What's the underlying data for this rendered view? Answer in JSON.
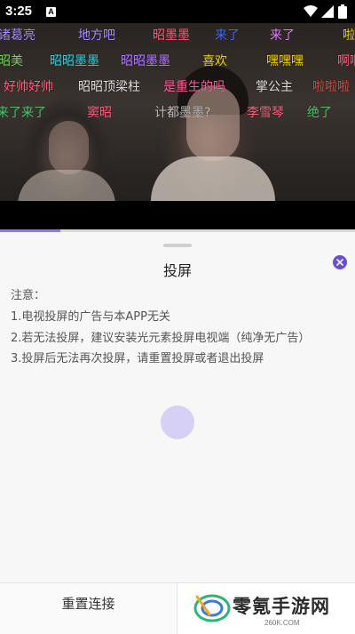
{
  "status": {
    "time": "3:25",
    "notification_glyph": "A"
  },
  "danmaku": [
    {
      "text": "诸葛亮",
      "color": "#a78bfa"
    },
    {
      "text": "地方吧",
      "color": "#a78bfa"
    },
    {
      "text": "昭墨墨",
      "color": "#ff5c7a"
    },
    {
      "text": "来了",
      "color": "#3b6bff"
    },
    {
      "text": "来了",
      "color": "#e27bff"
    },
    {
      "text": "啦",
      "color": "#f2d400"
    },
    {
      "text": "昭美",
      "color": "#7bd65b"
    },
    {
      "text": "昭昭墨墨",
      "color": "#46c9d6"
    },
    {
      "text": "昭昭墨墨",
      "color": "#b37bff"
    },
    {
      "text": "喜欢",
      "color": "#f2d400"
    },
    {
      "text": "嘿嘿嘿",
      "color": "#f2d400"
    },
    {
      "text": "啊啊",
      "color": "#ff5c7a"
    },
    {
      "text": "好帅好帅",
      "color": "#ff5c7a"
    },
    {
      "text": "昭昭顶梁柱",
      "color": "#dddddd"
    },
    {
      "text": "是重生的吗",
      "color": "#ff5c9a"
    },
    {
      "text": "掌公主",
      "color": "#dddddd"
    },
    {
      "text": "啦啦啦",
      "color": "#e0463c"
    },
    {
      "text": "来了来了",
      "color": "#46c96a"
    },
    {
      "text": "窦昭",
      "color": "#ff5c7a"
    },
    {
      "text": "计都墨墨?",
      "color": "#bbbbbb"
    },
    {
      "text": "李雪琴",
      "color": "#ff5c7a"
    },
    {
      "text": "绝了",
      "color": "#46c96a"
    }
  ],
  "progress": {
    "fraction": 0.17
  },
  "sheet": {
    "title": "投屏",
    "notice": [
      "注意：",
      "1.电视投屏的广告与本APP无关",
      "2.若无法投屏，建议安装光元素投屏电视端（纯净无广告）",
      "3.投屏后无法再次投屏，请重置投屏或者退出投屏"
    ],
    "reset_label": "重置连接"
  },
  "watermark": {
    "brand": "零氪手游网",
    "url": "260K.COM"
  },
  "colors": {
    "accent": "#6a4fd3",
    "spinner": "#d6d0f4"
  }
}
